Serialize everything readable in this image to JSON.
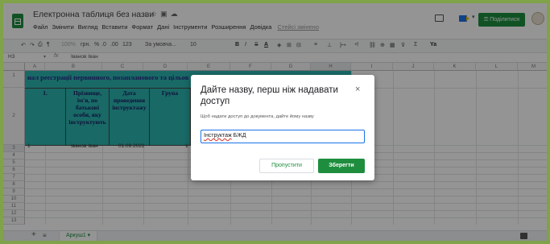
{
  "app": {
    "title": "Електронна таблиця без назви",
    "menu": [
      "Файл",
      "Змінити",
      "Вигляд",
      "Вставити",
      "Формат",
      "Дані",
      "Інструменти",
      "Розширення",
      "Довідка"
    ],
    "last_edit": "Стейсі змінено",
    "share_label": "Поділитися"
  },
  "toolbar": {
    "zoom": "100%",
    "currency": "грн.",
    "percent": "%",
    "decimal_dec": ".0",
    "decimal_inc": ".00",
    "number_format": "123",
    "font": "За умовча...",
    "font_size": "10",
    "bold": "B",
    "italic": "I",
    "strikethrough": "S",
    "text_color": "A",
    "more": "Ya"
  },
  "formula_bar": {
    "cell_ref": "H3",
    "content": "Іванов Іван"
  },
  "grid": {
    "columns": [
      "A",
      "B",
      "C",
      "D",
      "E",
      "F",
      "G",
      "H",
      "I",
      "J",
      "K",
      "L",
      "M"
    ],
    "rows": [
      "1",
      "2",
      "3",
      "4",
      "5",
      "6",
      "7",
      "8",
      "9",
      "10",
      "11",
      "12",
      "13"
    ],
    "row1_text": "нал реєстрації первинного, позапланового та цільов",
    "headers": {
      "b": "1.",
      "c": "Прізвище, ім'я, по батькові особи, яку інструктують",
      "d": "Дата проведення інструктажу",
      "e": "Група"
    },
    "row3": {
      "a": "1",
      "b": "Іванов Іван",
      "c": "01.09.2022",
      "d": "1"
    }
  },
  "dialog": {
    "title": "Дайте назву, перш ніж надавати доступ",
    "close": "×",
    "description": "Щоб надати доступ до документа, дайте йому назву",
    "input_value_misspelled": "Інструктаж",
    "input_value_rest": " БЖД",
    "skip_label": "Пропустити",
    "save_label": "Зберегти"
  },
  "sheetbar": {
    "add": "+",
    "all_sheets": "≡",
    "tab_label": "Аркуш1"
  }
}
